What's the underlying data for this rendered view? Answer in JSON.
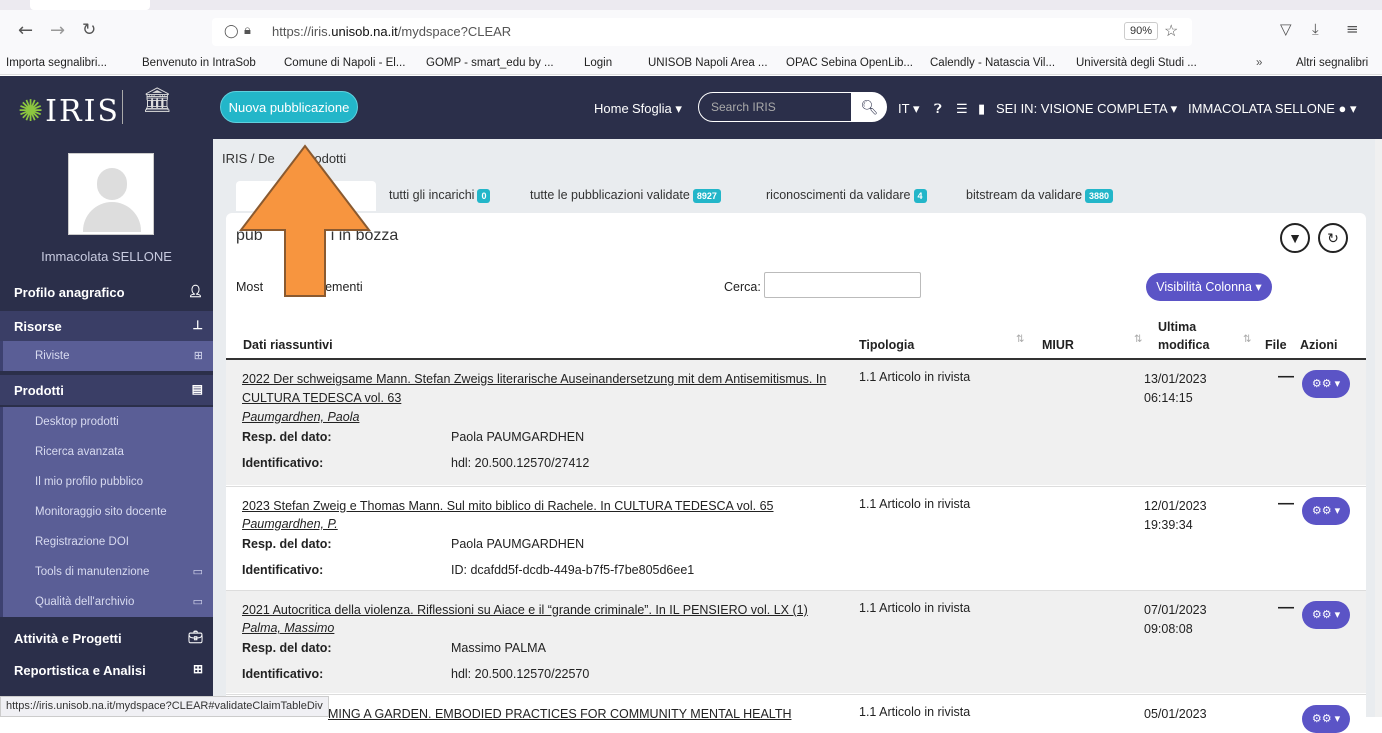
{
  "browser": {
    "url_prefix": "https://iris.",
    "url_domain": "unisob.na.it",
    "url_path": "/mydspace?CLEAR",
    "zoom": "90%",
    "bookmarks": [
      "Importa segnalibri...",
      "Benvenuto in IntraSob",
      "Comune di Napoli - El...",
      "GOMP - smart_edu by ...",
      "Login",
      "UNISOB Napoli Area ...",
      "OPAC Sebina OpenLib...",
      "Calendly - Natascia Vil...",
      "Università degli Studi ...",
      "Altri segnalibri"
    ]
  },
  "header": {
    "logo": "IRIS",
    "new_pub": "Nuova pubblicazione",
    "home": "Home",
    "sfoglia": "Sfoglia",
    "search_placeholder": "Search IRIS",
    "lang": "IT",
    "view": "SEI IN: VISIONE COMPLETA",
    "user": "IMMACOLATA SELLONE"
  },
  "sidebar": {
    "username": "Immacolata  SELLONE",
    "profilo": "Profilo anagrafico",
    "risorse": "Risorse",
    "riviste": "Riviste",
    "prodotti": "Prodotti",
    "items": [
      "Desktop prodotti",
      "Ricerca avanzata",
      "Il mio profilo pubblico",
      "Monitoraggio sito docente",
      "Registrazione DOI",
      "Tools di manutenzione",
      "Qualità dell'archivio"
    ],
    "attivita": "Attività e Progetti",
    "reportistica": "Reportistica e Analisi"
  },
  "main": {
    "bc_root": "IRIS",
    "bc_sep": "/",
    "bc_a": "De",
    "bc_b": "prodotti",
    "tabs": {
      "incarichi": "tutti gli incarichi",
      "incarichi_n": "0",
      "validate": "tutte le pubblicazioni validate",
      "validate_n": "8927",
      "ricon": "riconoscimenti da validare",
      "ricon_n": "4",
      "bitstream": "bitstream da validare",
      "bitstream_n": "3880"
    },
    "title_a": "pub",
    "title_b": "i in bozza",
    "mostra_a": "Most",
    "mostra_b": "ementi",
    "cerca": "Cerca:",
    "colvis": "Visibilità Colonna",
    "headers": {
      "dati": "Dati riassuntivi",
      "tipologia": "Tipologia",
      "miur": "MIUR",
      "ultima": "Ultima",
      "modifica": "modifica",
      "file": "File",
      "azioni": "Azioni"
    },
    "lbl_resp": "Resp. del dato:",
    "lbl_id": "Identificativo:",
    "rows": [
      {
        "title": "2022 Der schweigsame Mann. Stefan Zweigs literarische Auseinandersetzung mit dem Antisemitismus. In CULTURA TEDESCA vol. 63",
        "author": "Paumgardhen, Paola",
        "resp": "Paola PAUMGARDHEN",
        "id": "hdl: 20.500.12570/27412",
        "type": "1.1 Articolo in rivista",
        "date": "13/01/2023",
        "time": "06:14:15",
        "file": "—"
      },
      {
        "title": "2023 Stefan Zweig e Thomas Mann. Sul mito biblico di Rachele. In CULTURA TEDESCA vol. 65",
        "author": "Paumgardhen, P.",
        "resp": "Paola PAUMGARDHEN",
        "id": "ID: dcafdd5f-dcdb-449a-b7f5-f7be805d6ee1",
        "type": "1.1 Articolo in rivista",
        "date": "12/01/2023",
        "time": "19:39:34",
        "file": "—"
      },
      {
        "title": "2021 Autocritica della violenza. Riflessioni su Aiace e il “grande criminale”. In IL PENSIERO vol. LX (1)",
        "author": "Palma, Massimo",
        "resp": "Massimo PALMA",
        "id": "hdl: 20.500.12570/22570",
        "type": "1.1 Articolo in rivista",
        "date": "07/01/2023",
        "time": "09:08:08",
        "file": "—"
      },
      {
        "title": "MING A GARDEN. EMBODIED PRACTICES FOR COMMUNITY MENTAL HEALTH",
        "type": "1.1 Articolo in rivista",
        "date": "05/01/2023"
      }
    ]
  },
  "status_url": "https://iris.unisob.na.it/mydspace?CLEAR#validateClaimTableDiv",
  "colors": {
    "navy": "#2b2f4a",
    "teal": "#23b6c9",
    "purple": "#5b54c6",
    "arrow": "#f7953f"
  }
}
